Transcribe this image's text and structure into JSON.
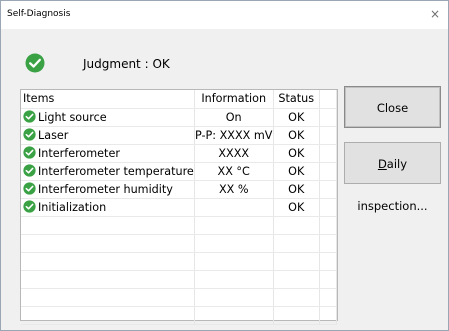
{
  "window": {
    "title": "Self-Diagnosis",
    "close_glyph": "×"
  },
  "judgment": {
    "label": "Judgment :",
    "value": "OK",
    "icon": "check-circle-icon",
    "color": "#3aa245"
  },
  "table": {
    "columns": [
      "Items",
      "Information",
      "Status"
    ],
    "rows": [
      {
        "item": "Light source",
        "info": "On",
        "status": "OK"
      },
      {
        "item": "Laser",
        "info": "P-P: XXXX mV",
        "status": "OK"
      },
      {
        "item": "Interferometer",
        "info": "XXXX",
        "status": "OK"
      },
      {
        "item": "Interferometer temperature",
        "info": "XX °C",
        "status": "OK"
      },
      {
        "item": "Interferometer humidity",
        "info": "XX %",
        "status": "OK"
      },
      {
        "item": "Initialization",
        "info": "",
        "status": "OK"
      }
    ],
    "empty_rows": 6
  },
  "buttons": {
    "close_label": "Close",
    "daily_label_first": "D",
    "daily_label_rest": "aily inspection..."
  }
}
